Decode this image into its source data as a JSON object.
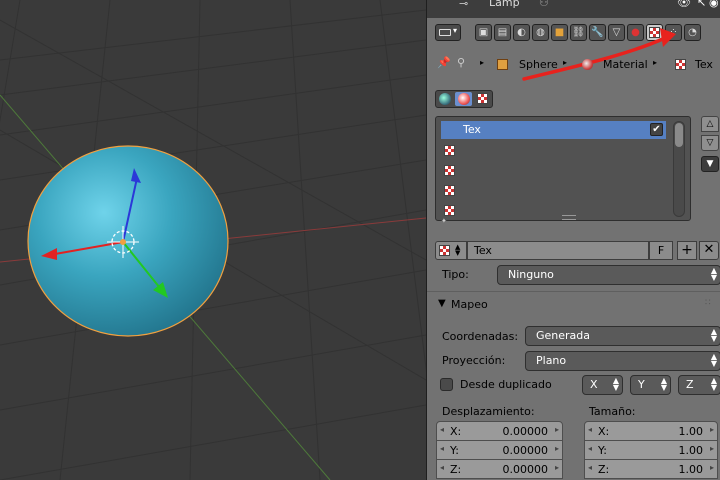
{
  "outliner": {
    "lamp_label": "Lamp"
  },
  "breadcrumb": {
    "object": "Sphere",
    "material": "Material",
    "texture": "Tex"
  },
  "texture_slots": {
    "active_label": "Tex"
  },
  "datablock": {
    "name": "Tex",
    "fake_user": "F"
  },
  "type_row": {
    "label": "Tipo:",
    "value": "Ninguno"
  },
  "mapping_panel": {
    "title": "Mapeo",
    "coordinates_label": "Coordenadas:",
    "coordinates_value": "Generada",
    "projection_label": "Proyección:",
    "projection_value": "Plano",
    "from_dupli_label": "Desde duplicado",
    "axis_x": "X",
    "axis_y": "Y",
    "axis_z": "Z",
    "offset_label": "Desplazamiento:",
    "size_label": "Tamaño:",
    "offset": [
      {
        "axis": "X:",
        "value": "0.00000"
      },
      {
        "axis": "Y:",
        "value": "0.00000"
      },
      {
        "axis": "Z:",
        "value": "0.00000"
      }
    ],
    "size": [
      {
        "axis": "X:",
        "value": "1.00"
      },
      {
        "axis": "Y:",
        "value": "1.00"
      },
      {
        "axis": "Z:",
        "value": "1.00"
      }
    ]
  },
  "colors": {
    "viewport_bg": "#3a3a3a",
    "panel_bg": "#727272",
    "selection_blue": "#5680c2",
    "sphere": "#3aa5bf",
    "annotation_red": "#e8221d"
  }
}
